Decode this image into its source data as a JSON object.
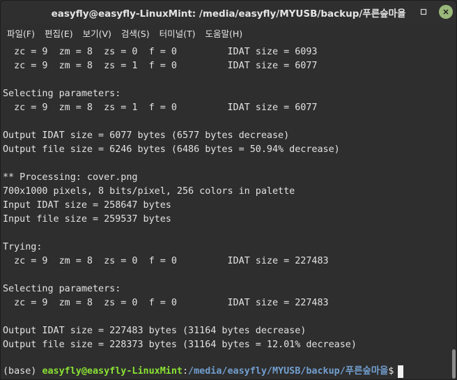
{
  "window": {
    "title": "easyfly@easyfly-LinuxMint: /media/easyfly/MYUSB/backup/푸른숲마을",
    "accent_close": "#9ab87a"
  },
  "menu": [
    {
      "label": "파일(F)"
    },
    {
      "label": "편집(E)"
    },
    {
      "label": "보기(V)"
    },
    {
      "label": "검색(S)"
    },
    {
      "label": "터미널(T)"
    },
    {
      "label": "도움말(H)"
    }
  ],
  "terminal": {
    "lines": [
      "  zc = 9  zm = 8  zs = 0  f = 0         IDAT size = 6093",
      "  zc = 9  zm = 8  zs = 1  f = 0         IDAT size = 6077",
      "",
      "Selecting parameters:",
      "  zc = 9  zm = 8  zs = 1  f = 0         IDAT size = 6077",
      "",
      "Output IDAT size = 6077 bytes (6577 bytes decrease)",
      "Output file size = 6246 bytes (6486 bytes = 50.94% decrease)",
      "",
      "** Processing: cover.png",
      "700x1000 pixels, 8 bits/pixel, 256 colors in palette",
      "Input IDAT size = 258647 bytes",
      "Input file size = 259537 bytes",
      "",
      "Trying:",
      "  zc = 9  zm = 8  zs = 0  f = 0         IDAT size = 227483",
      "",
      "Selecting parameters:",
      "  zc = 9  zm = 8  zs = 0  f = 0         IDAT size = 227483",
      "",
      "Output IDAT size = 227483 bytes (31164 bytes decrease)",
      "Output file size = 228373 bytes (31164 bytes = 12.01% decrease)"
    ],
    "prompt": {
      "env": "(base) ",
      "user_host": "easyfly@easyfly-LinuxMint",
      "colon": ":",
      "path": "/media/easyfly/MYUSB/backup/푸른숲마을",
      "dollar": "$"
    },
    "colors": {
      "user_host": "#8ae234",
      "path": "#729fcf",
      "text": "#e3e3e3",
      "background": "#2e2e2e"
    }
  }
}
